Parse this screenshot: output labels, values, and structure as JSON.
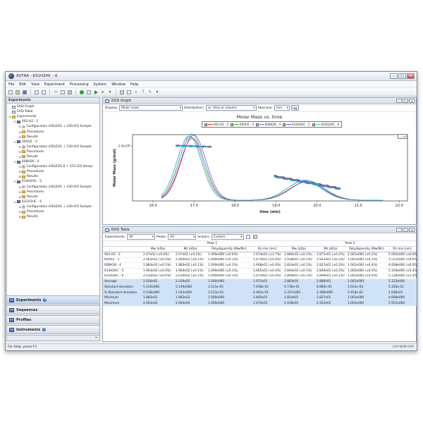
{
  "window": {
    "title": "ASTRA - 631H2HC - 6"
  },
  "menu": [
    "File",
    "Edit",
    "View",
    "Experiment",
    "Processing",
    "System",
    "Window",
    "Help"
  ],
  "sidebar": {
    "title": "Experiments",
    "top_items": [
      "EASI Graph",
      "EASI Table"
    ],
    "root": "Experiments",
    "experiments": [
      {
        "name": "602-H2 - 2",
        "config": "Configuration (HELEOS + 230-rEX Sample"
      },
      {
        "name": "605H2 - 3",
        "config": "Configuration (HELEOS + 230-rEX Sample"
      },
      {
        "name": "608H28 - 4",
        "config": "Configuration (HELEOS 8 + 372-rEX Sampl"
      },
      {
        "name": "614H2HC - 5",
        "config": "Configuration (HELEOS + 230-rEX Sample"
      },
      {
        "name": "631H2HC - 6",
        "config": "Configuration (HELEOS + 230-rEX Sample"
      }
    ],
    "procedures_label": "Procedures",
    "results_label": "Results",
    "nav": [
      {
        "label": "Experiments",
        "badge": "5"
      },
      {
        "label": "Sequences"
      },
      {
        "label": "Profiles"
      },
      {
        "label": "Instruments",
        "badge": "1"
      }
    ],
    "more": "»"
  },
  "graph": {
    "title": "EASI Graph",
    "display_label": "Display:",
    "display_value": "Molar mass",
    "distribution_label": "Distribution:",
    "distribution_value": "vs. time or volume",
    "abscissa_label": "Abscissa:",
    "abscissa_value": "min",
    "log_label": "log",
    "ls_label": "— LS",
    "colors": [
      "#e41a1c",
      "#4daf4a",
      "#377eb8",
      "#8a2be2",
      "#2f2f2f",
      "#17becf"
    ]
  },
  "chart_data": {
    "type": "line",
    "title": "Molar Mass vs. time",
    "xlabel": "time (min)",
    "ylabel": "Molar Mass (g/mol)",
    "y_tick_label": "1.0x10⁵",
    "xlim": [
      15.5,
      22.2
    ],
    "x_ticks": [
      16.0,
      17.0,
      18.0,
      19.0,
      20.0,
      21.0,
      22.0
    ],
    "series": [
      {
        "name": "602-H2 - 2",
        "color": "#e41a1c",
        "peak1_center": 16.96,
        "peak2_center": 19.74
      },
      {
        "name": "605H2 - 3",
        "color": "#4daf4a",
        "peak1_center": 16.92,
        "peak2_center": 19.78
      },
      {
        "name": "608H28 - 4",
        "color": "#377eb8",
        "peak1_center": 16.88,
        "peak2_center": 19.7
      },
      {
        "name": "614H2HC - 5",
        "color": "#8a2be2",
        "peak1_center": 16.99,
        "peak2_center": 19.75
      },
      {
        "name": "631H2HC - 6",
        "color": "#17becf",
        "peak1_center": 16.94,
        "peak2_center": 19.68
      }
    ]
  },
  "table": {
    "title": "EASI Table",
    "experiments_label": "Experiments:",
    "experiments_value": "All",
    "peaks_label": "Peaks:",
    "peaks_value": "All",
    "scalars_label": "Scalars:",
    "scalars_value": "Custom",
    "peak1": "Peak 1",
    "peak2": "Peak 2",
    "columns": [
      "Mw (kDa)",
      "Mz (kDa)",
      "Polydispersity (Mw/Mn)",
      "Rz rms (nm)",
      "Mw (kDa)",
      "Mz (kDa)",
      "Polydispersity (Mw/Mn)",
      "Rz rms (nm)"
    ],
    "rows": [
      [
        "602-H2 - 2",
        "2.07e02 (±0.0%)",
        "2.07e02 (±0.1%)",
        "1.000e000 (±0.0%)",
        "1.674e01 (±3.7%)",
        "2.866e01 (±0.1%)",
        "2.871e01 (±0.2%)",
        "1.001e000 (±0.2%)",
        "5.092e000 (±6.0%)"
      ],
      [
        "605H2 - 3",
        "2.063e02 (±0.0%)",
        "2.064e02 (±0.1%)",
        "1.000e000 (±0.1%)",
        "1.675e01 (±0.4%)",
        "2.918e01 (±0.1%)",
        "2.922e01 (±0.2%)",
        "1.001e000 (±0.3%)",
        "5.551e000 (±9.6%)"
      ],
      [
        "608H28 - 4",
        "1.883e02 (±0.1%)",
        "1.883e02 (±0.1%)",
        "1.000e000 (±0.1%)",
        "1.668e01 (±0.6%)",
        "2.824e01 (±0.1%)",
        "2.827e01 (±0.2%)",
        "1.001e000 (±0.4%)",
        "4.668e000 (±6.6%)"
      ],
      [
        "614H2HC - 5",
        "1.963e02 (±0.0%)",
        "1.964e02 (±0.1%)",
        "1.000e000 (±0.1%)",
        "1.665e01 (±0.4%)",
        "2.844e01 (±0.1%)",
        "2.849e01 (±0.2%)",
        "1.002e000 (±0.3%)",
        "5.104e000 (±5.4%)"
      ],
      [
        "631H2HC - 6",
        "2.033e02 (±0.0%)",
        "2.034e02 (±0.1%)",
        "1.000e000 (±0.1%)",
        "1.675e01 (±0.4%)",
        "2.894e01 (±0.1%)",
        "2.899e01 (±0.1%)",
        "1.002e000 (±0.4%)",
        "5.130e000 (±5.4%)"
      ]
    ],
    "stat_rows": [
      [
        "Average",
        "2.026e02",
        "2.026e02",
        "1.000e000",
        "1.671e01",
        "2.883e01",
        "2.886e01",
        "1.001e000",
        "5.123e000"
      ],
      [
        "Standard deviation",
        "5.142e000",
        "5.149e000",
        "3.511e-05",
        "7.458e-02",
        "6.736e-01",
        "6.885e-01",
        "5.922e-04",
        "5.326e-01"
      ],
      [
        "% Standard deviation",
        "2.538e000",
        "2.542e000",
        "3.511e-03",
        "4.462e-01",
        "2.337e000",
        "2.386e000",
        "5.914e-02",
        "1.040e01"
      ],
      [
        "Minimum",
        "1.883e02",
        "1.883e02",
        "1.000e000",
        "1.665e01",
        "2.824e01",
        "2.827e01",
        "1.001e000",
        "4.668e000"
      ],
      [
        "Maximum",
        "2.063e02",
        "2.064e02",
        "1.000e000",
        "1.675e01",
        "2.918e01",
        "2.922e01",
        "1.002e000",
        "5.551e000"
      ]
    ]
  },
  "status": {
    "text": "For Help, press F1",
    "indicators": "CAP  NUM  OVR"
  }
}
